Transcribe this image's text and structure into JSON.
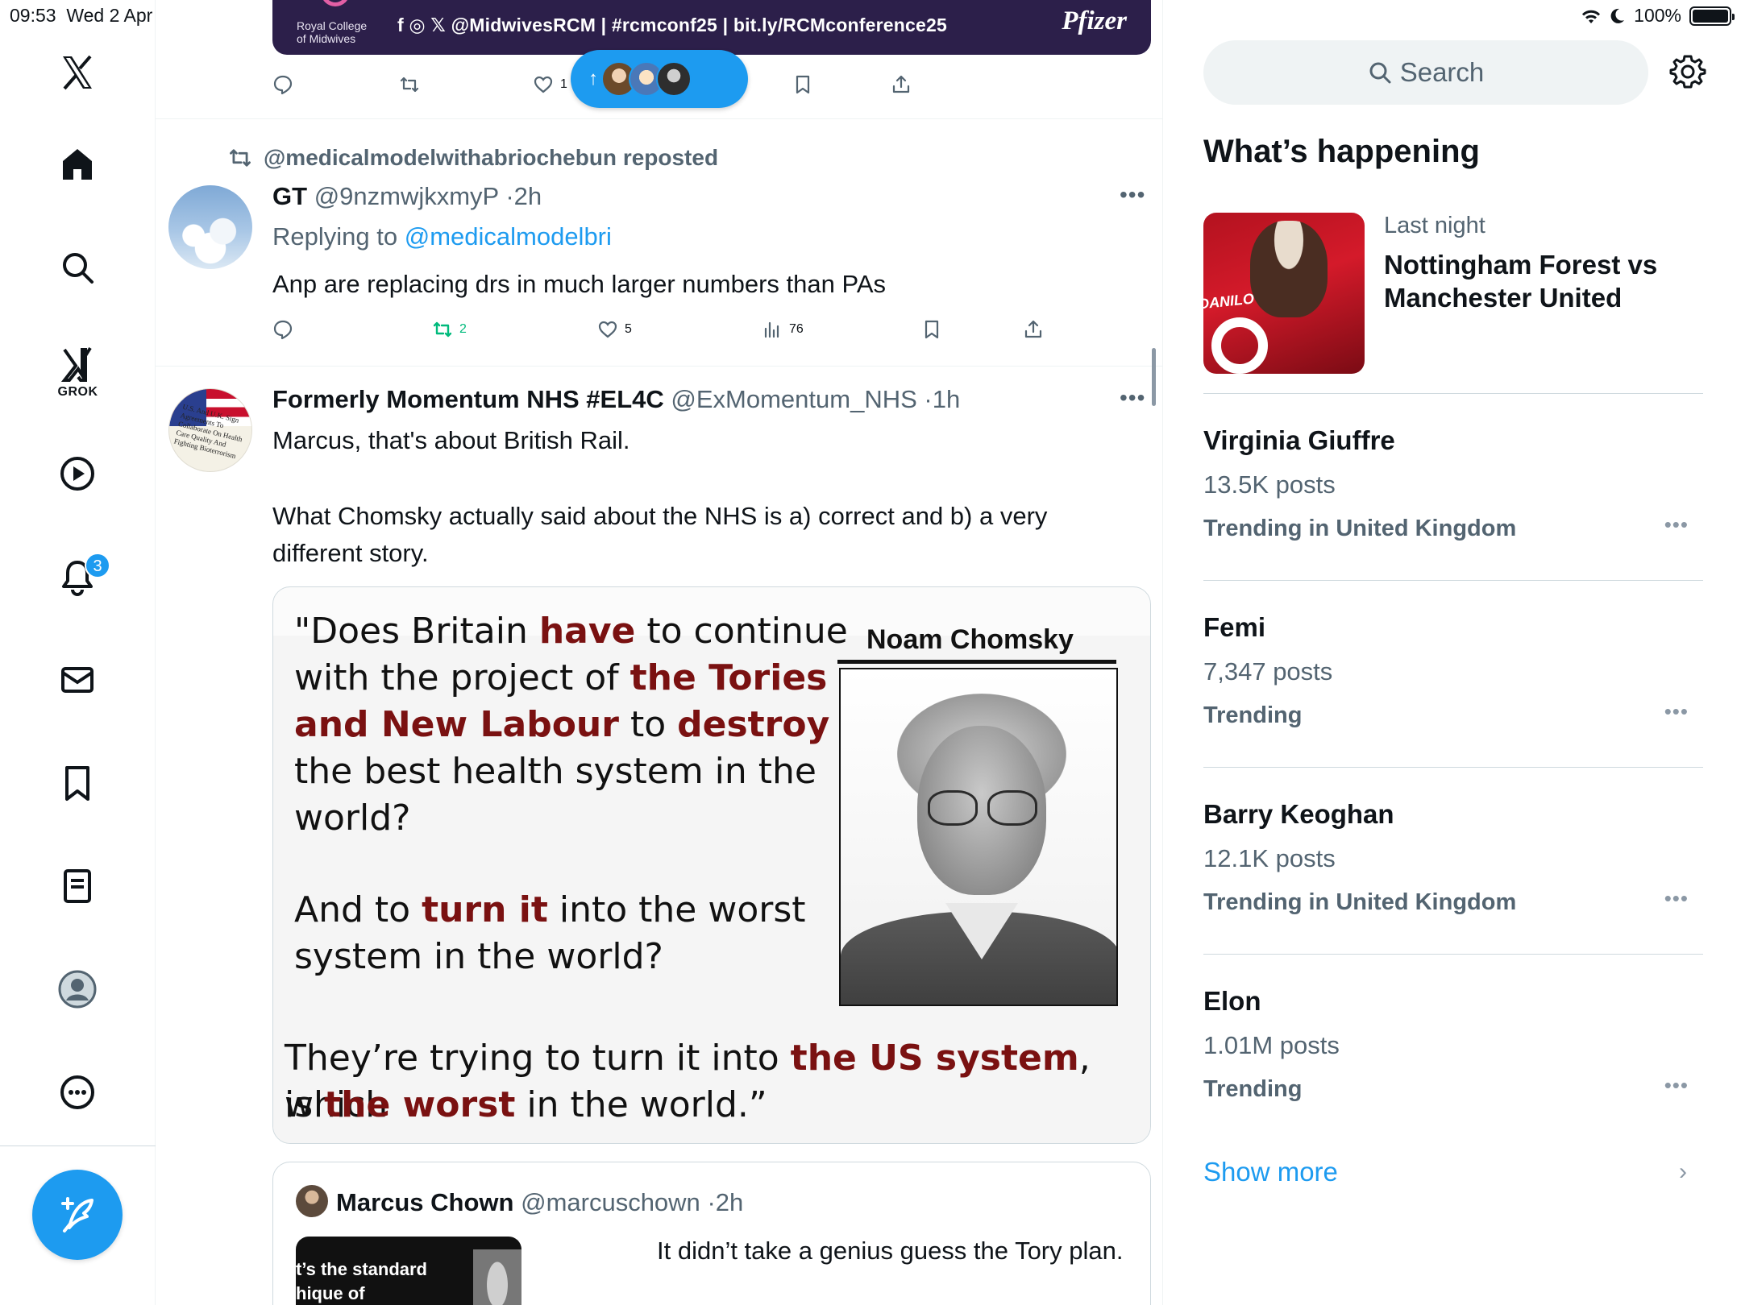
{
  "status_bar": {
    "time": "09:53",
    "date": "Wed 2 Apr",
    "battery": "100%"
  },
  "nav": {
    "grok_label": "GROK",
    "notification_count": "3",
    "icons": [
      "x-logo-icon",
      "home-icon",
      "search-icon",
      "grok-icon",
      "video-icon",
      "bell-icon",
      "mail-icon",
      "bookmark-icon",
      "list-icon",
      "profile-icon",
      "more-icon",
      "compose-icon"
    ]
  },
  "banner": {
    "org": "Royal College\nof Midwives",
    "text": "f ◎ 𝕏 @MidwivesRCM  |  #rcmconf25  |  bit.ly/RCMconference25",
    "sponsor": "Pfizer"
  },
  "top_actions": {
    "likes": "1"
  },
  "post1": {
    "repost_label": "@medicalmodelwithabriochebun reposted",
    "name": "GT",
    "handle": "@9nzmwjkxmyP",
    "time": "2h",
    "replying_prefix": "Replying to ",
    "replying_to": "@medicalmodelbri",
    "text": "Anp are replacing drs in much larger numbers than PAs",
    "reposts": "2",
    "likes": "5",
    "views": "76"
  },
  "post2": {
    "name": "Formerly Momentum NHS #EL4C",
    "handle": "@ExMomentum_NHS",
    "time": "1h",
    "text_line1": "Marcus, that's about British Rail.",
    "text_line2": "What Chomsky actually said about the NHS is a) correct and b) a very different story.",
    "avatar_text": "U.S. And U.K. Sign Agreements To Collaborate On Health Care Quality And Fighting Bioterrorism"
  },
  "quote_image": {
    "label": "Noam Chomsky",
    "q1_a": "\"Does Britain ",
    "q1_b": "have",
    "q1_c": " to continue",
    "q2": "with the project of ",
    "q2_b": "the Tories",
    "q3_a": "and New Labour",
    "q3_b": " to ",
    "q3_c": "destroy",
    "q4": "the best health system in the",
    "q5": "world?",
    "q6_a": "And to ",
    "q6_b": "turn it",
    "q6_c": " into the worst",
    "q7": "system in the world?",
    "q8_a": "They’re trying to turn it into ",
    "q8_b": "the US system",
    "q8_c": ", which",
    "q9_a": "is ",
    "q9_b": "the worst",
    "q9_c": " in the world.”"
  },
  "quoted_tweet": {
    "name": "Marcus Chown",
    "handle": "@marcuschown",
    "time": "2h",
    "text": "It didn’t take a genius guess the Tory plan.",
    "thumb_text": "t’s the standard\nhique of"
  },
  "sidebar": {
    "search_placeholder": "Search",
    "title": "What’s happening",
    "feature": {
      "meta": "Last night",
      "title": "Nottingham Forest vs Manchester United",
      "shirt_text": "DANILO"
    },
    "trends": [
      {
        "name": "Virginia Giuffre",
        "count": "13.5K posts",
        "context": "Trending in United Kingdom"
      },
      {
        "name": "Femi",
        "count": "7,347 posts",
        "context": "Trending"
      },
      {
        "name": "Barry Keoghan",
        "count": "12.1K posts",
        "context": "Trending in United Kingdom"
      },
      {
        "name": "Elon",
        "count": "1.01M posts",
        "context": "Trending"
      }
    ],
    "show_more": "Show more"
  },
  "colors": {
    "accent": "#1d9bf0",
    "repost_green": "#00ba7c",
    "quote_highlight": "#7a1111",
    "banner_bg": "#2c1f4a"
  }
}
